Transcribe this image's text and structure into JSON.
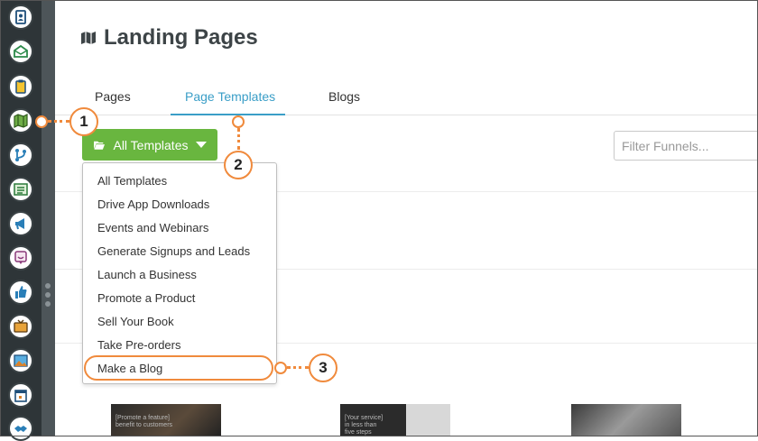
{
  "page": {
    "title": "Landing Pages"
  },
  "tabs": [
    {
      "label": "Pages",
      "active": false
    },
    {
      "label": "Page Templates",
      "active": true
    },
    {
      "label": "Blogs",
      "active": false
    }
  ],
  "templates_button": {
    "label": "All Templates"
  },
  "filter": {
    "placeholder": "Filter Funnels..."
  },
  "dropdown": {
    "items": [
      "All Templates",
      "Drive App Downloads",
      "Events and Webinars",
      "Generate Signups and Leads",
      "Launch a Business",
      "Promote a Product",
      "Sell Your Book",
      "Take Pre-orders",
      "Make a Blog"
    ],
    "highlighted": "Make a Blog"
  },
  "callouts": [
    "1",
    "2",
    "3"
  ],
  "sidebar": {
    "icons": [
      "contacts-icon",
      "email-icon",
      "clipboard-icon",
      "map-icon",
      "branch-icon",
      "list-icon",
      "megaphone-icon",
      "chat-icon",
      "thumbs-up-icon",
      "tv-icon",
      "image-icon",
      "calendar-icon",
      "handshake-icon"
    ]
  },
  "thumbnails": [
    {
      "caption": "[Promote a feature]\nbenefit to customers"
    },
    {
      "caption": "[Your service]\nin less than\nfive steps"
    },
    {
      "caption": ""
    }
  ],
  "colors": {
    "accent": "#3a9ec7",
    "button": "#69b63f",
    "annotation": "#f08a3c",
    "sidebar": "#2e3538"
  }
}
